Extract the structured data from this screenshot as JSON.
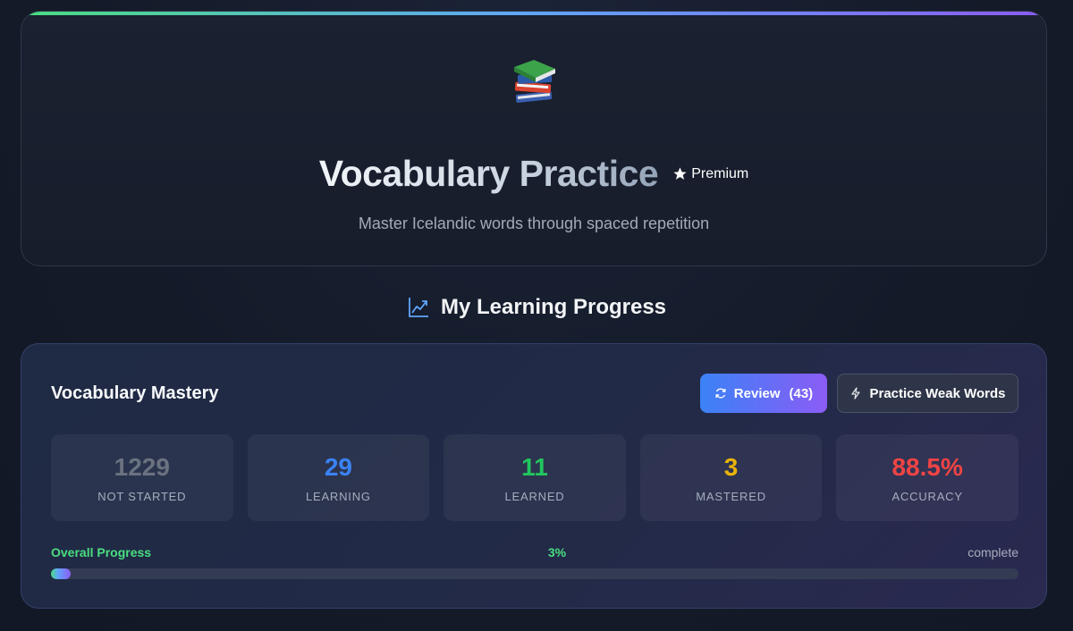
{
  "hero": {
    "icon": "books-icon",
    "title": "Vocabulary Practice",
    "badge": "Premium",
    "subtitle": "Master Icelandic words through spaced repetition"
  },
  "section": {
    "icon": "trending-up-icon",
    "title": "My Learning Progress"
  },
  "mastery": {
    "title": "Vocabulary Mastery",
    "review_button": {
      "label": "Review",
      "count": "(43)",
      "icon": "refresh-icon"
    },
    "weak_button": {
      "label": "Practice Weak Words",
      "icon": "lightning-icon"
    },
    "stats": [
      {
        "value": "1229",
        "label": "NOT STARTED",
        "color": "#6b7280"
      },
      {
        "value": "29",
        "label": "LEARNING",
        "color": "#3b82f6"
      },
      {
        "value": "11",
        "label": "LEARNED",
        "color": "#22c55e"
      },
      {
        "value": "3",
        "label": "MASTERED",
        "color": "#eab308"
      },
      {
        "value": "88.5%",
        "label": "ACCURACY",
        "color": "#ef4444"
      }
    ],
    "progress": {
      "label": "Overall Progress",
      "percent_text": "3%",
      "suffix": "complete",
      "fraction": 0.02
    }
  },
  "colors": {
    "accent_green": "#4ade80",
    "accent_blue": "#60a5fa",
    "accent_purple": "#8b5cf6"
  }
}
